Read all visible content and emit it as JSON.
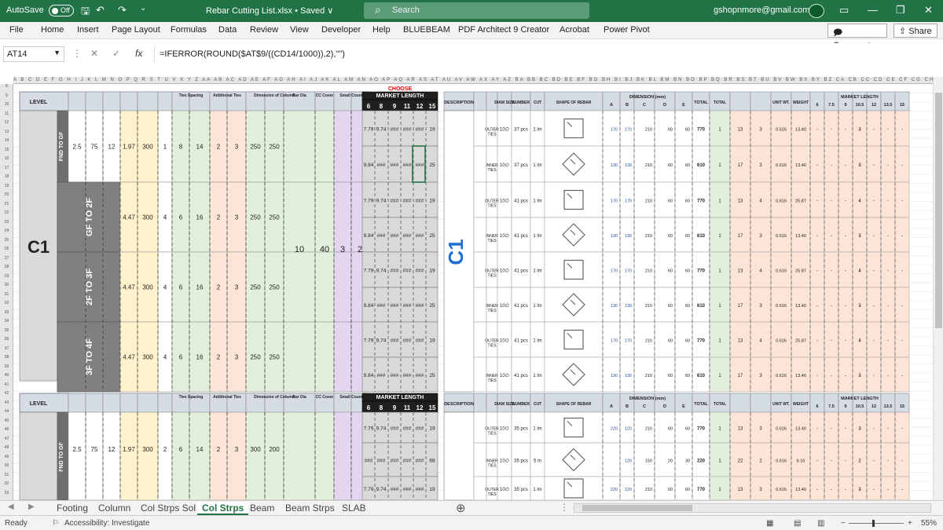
{
  "title_bar": {
    "autosave_label": "AutoSave",
    "autosave_state": "Off",
    "file_title": "Rebar Cutting List.xlsx • Saved ∨",
    "search_placeholder": "Search",
    "user_email": "gshopnmore@gmail.com",
    "window_buttons": [
      "▭",
      "—",
      "❐",
      "✕"
    ]
  },
  "menu": {
    "tabs": [
      "File",
      "Home",
      "Insert",
      "Page Layout",
      "Formulas",
      "Data",
      "Review",
      "View",
      "Developer",
      "Help",
      "BLUEBEAM",
      "PDF Architect 9 Creator",
      "Acrobat",
      "Power Pivot"
    ],
    "comments_label": "Comments",
    "share_label": "Share"
  },
  "formula_bar": {
    "name_box": "AT14",
    "formula": "=IFERROR(ROUND($AT$9/((CD14/1000)),2),\"\")"
  },
  "sheet": {
    "choose_label": "CHOOSE",
    "column_letters": "A B C D E F G H I J K L M N O P Q R S T U V X Y Z AA AB AC AD AE AF AG AH AI AJ AK AL AM AN AO AP AQ AR AS AT AU AV AW AX AY AZ BA BB BC BD BE BF BG BH BI BJ BK BL BM BN BO BP BQ BR BS BT BU BV BW BX BY BZ CA CB CC CD CE CF CG CH CI CJ CK CL CM CN CO CP CQ CR CS CT CU CV CW CX CY CZ DA DB DC DD DE DF DG DH DI DJ DK DL DM DN",
    "row_numbers": [
      "8",
      "9",
      "10",
      "11",
      "12",
      "13",
      "14",
      "15",
      "16",
      "17",
      "18",
      "19",
      "20",
      "21",
      "22",
      "23",
      "24",
      "25",
      "26",
      "27",
      "28",
      "29",
      "30",
      "31",
      "32",
      "33",
      "34",
      "35",
      "36",
      "37",
      "38",
      "39",
      "40",
      "41",
      "42",
      "43",
      "44",
      "45",
      "46",
      "47",
      "48",
      "49",
      "50",
      "51",
      "52",
      "53"
    ],
    "header_block": {
      "level": "LEVEL",
      "market_length": "MARKET LENGTH",
      "description": "DESCRIPTION",
      "dia_size": "DIAM SIZE",
      "number_pcs": "NUMBER OF PCS AT EACH",
      "length_cut": "LENGTH TO CUT",
      "shape": "SHAPE OF REBAR",
      "dimension": "DIMENSION (mm)",
      "dim_cols": [
        "A",
        "B",
        "C",
        "D",
        "E"
      ],
      "total": "TOTAL",
      "total_sets": "TOTAL NUMBER OF SETS",
      "produce": "PCS PRODUCE D FOR EACH BAR",
      "number_market": "NUMBER MARKET SAW LENGTH",
      "unit_wt": "UNIT WT.",
      "weight": "WEIGHT",
      "market_length_right": "MARKET LENGTH",
      "mlr_cols": [
        "6",
        "7.5",
        "9",
        "10.5",
        "12",
        "13.5",
        "15"
      ],
      "ml_cols": [
        "6",
        "8",
        "9",
        "11",
        "12",
        "15"
      ],
      "group_tiles": "Ties Spacing",
      "group_add": "Additional Ties",
      "group_dim": "Dimension of Column",
      "group_cc": "CC Cover",
      "group_bar": "Bar Dia",
      "group_small": "Small Count"
    },
    "column_name": "C1",
    "levels": [
      "FND TO GF",
      "GF TO 2F",
      "2F TO 3F",
      "3F TO 4F"
    ],
    "level_values": [
      {
        "d": "2.5",
        "e": "75",
        "f": "12",
        "g": "1.97",
        "h": "300",
        "i": "1",
        "j": "8",
        "k": "14",
        "l": "2",
        "m": "3",
        "n": "250",
        "o": "250"
      },
      {
        "d": "",
        "e": "",
        "f": "",
        "g": "4.47",
        "h": "300",
        "i": "4",
        "j": "6",
        "k": "16",
        "l": "2",
        "m": "3",
        "n": "250",
        "o": "250"
      },
      {
        "d": "",
        "e": "",
        "f": "",
        "g": "4.47",
        "h": "300",
        "i": "4",
        "j": "6",
        "k": "16",
        "l": "2",
        "m": "3",
        "n": "250",
        "o": "250"
      },
      {
        "d": "",
        "e": "",
        "f": "",
        "g": "4.47",
        "h": "300",
        "i": "4",
        "j": "6",
        "k": "16",
        "l": "2",
        "m": "3",
        "n": "250",
        "o": "250"
      }
    ],
    "shared_vals": [
      "10",
      "40",
      "3",
      "2"
    ],
    "ml_rows": [
      [
        "7.79",
        "9.74",
        "###",
        "###",
        "###",
        "19"
      ],
      [
        "9.84",
        "###",
        "###",
        "###",
        "###",
        "25"
      ]
    ],
    "tie_rows": [
      {
        "desc": "OUTER TIES",
        "dia": "10∅",
        "pcs": "37 pcs",
        "cut": "1 lm",
        "dims": [
          "170",
          "170",
          "210",
          "60",
          "60"
        ],
        "total": "770",
        "sets": "1",
        "prod": "13",
        "num": "3",
        "wt": "0.616",
        "weight": "13.40",
        "mlr": "3"
      },
      {
        "desc": "INNER TIES",
        "dia": "10∅",
        "pcs": "37 pcs",
        "cut": "1 lm",
        "dims": [
          "130",
          "130",
          "210",
          "60",
          "60"
        ],
        "total": "610",
        "sets": "1",
        "prod": "17",
        "num": "3",
        "wt": "0.616",
        "weight": "13.40",
        "mlr": "3"
      },
      {
        "desc": "OUTER TIES",
        "dia": "10∅",
        "pcs": "41 pcs",
        "cut": "1 lm",
        "dims": [
          "170",
          "170",
          "210",
          "60",
          "60"
        ],
        "total": "770",
        "sets": "1",
        "prod": "13",
        "num": "4",
        "wt": "0.616",
        "weight": "25.87",
        "mlr": "4"
      },
      {
        "desc": "INNER TIES",
        "dia": "10∅",
        "pcs": "41 pcs",
        "cut": "1 lm",
        "dims": [
          "130",
          "130",
          "210",
          "60",
          "60"
        ],
        "total": "610",
        "sets": "1",
        "prod": "17",
        "num": "3",
        "wt": "0.616",
        "weight": "13.40",
        "mlr": "3"
      },
      {
        "desc": "OUTER TIES",
        "dia": "10∅",
        "pcs": "41 pcs",
        "cut": "1 lm",
        "dims": [
          "170",
          "170",
          "210",
          "60",
          "60"
        ],
        "total": "770",
        "sets": "1",
        "prod": "13",
        "num": "4",
        "wt": "0.616",
        "weight": "25.87",
        "mlr": "4"
      },
      {
        "desc": "INNER TIES",
        "dia": "10∅",
        "pcs": "41 pcs",
        "cut": "1 lm",
        "dims": [
          "130",
          "130",
          "210",
          "60",
          "60"
        ],
        "total": "610",
        "sets": "1",
        "prod": "17",
        "num": "3",
        "wt": "0.616",
        "weight": "13.40",
        "mlr": "3"
      },
      {
        "desc": "OUTER TIES",
        "dia": "10∅",
        "pcs": "41 pcs",
        "cut": "1 lm",
        "dims": [
          "170",
          "170",
          "210",
          "60",
          "60"
        ],
        "total": "770",
        "sets": "1",
        "prod": "13",
        "num": "4",
        "wt": "0.616",
        "weight": "25.87",
        "mlr": "4"
      },
      {
        "desc": "INNER TIES",
        "dia": "10∅",
        "pcs": "41 pcs",
        "cut": "1 lm",
        "dims": [
          "130",
          "130",
          "210",
          "60",
          "60"
        ],
        "total": "610",
        "sets": "1",
        "prod": "17",
        "num": "3",
        "wt": "0.616",
        "weight": "13.40",
        "mlr": "3"
      }
    ],
    "bottom_block": {
      "level": "FND TO GF",
      "values": {
        "d": "2.5",
        "e": "75",
        "f": "12",
        "g": "1.97",
        "h": "300",
        "i": "2",
        "j": "6",
        "k": "14",
        "l": "2",
        "m": "3",
        "n": "300",
        "o": "200"
      },
      "ml_rows": [
        [
          "7.79",
          "9.74",
          "###",
          "###",
          "###",
          "19"
        ],
        [
          "###",
          "###",
          "###",
          "###",
          "###",
          "68"
        ],
        [
          "7.79",
          "9.74",
          "###",
          "###",
          "###",
          "19"
        ]
      ],
      "tie_rows": [
        {
          "desc": "OUTER TIES",
          "dia": "10∅",
          "pcs": "35 pcs",
          "cut": "1 lm",
          "dims": [
            "220",
            "120",
            "210",
            "60",
            "60"
          ],
          "total": "770",
          "sets": "1",
          "prod": "13",
          "num": "3",
          "wt": "0.616",
          "weight": "13.40",
          "mlr": "3"
        },
        {
          "desc": "INNER TIES",
          "dia": "10∅",
          "pcs": "35 pcs",
          "cut": "5 m",
          "dims": [
            "",
            "120",
            "150",
            "20",
            "30"
          ],
          "total": "220",
          "sets": "1",
          "prod": "22",
          "num": "2",
          "wt": "0.616",
          "weight": "6.16",
          "mlr": "2"
        },
        {
          "desc": "OUTER TIES",
          "dia": "10∅",
          "pcs": "35 pcs",
          "cut": "1 lm",
          "dims": [
            "220",
            "120",
            "210",
            "60",
            "60"
          ],
          "total": "770",
          "sets": "1",
          "prod": "13",
          "num": "3",
          "wt": "0.616",
          "weight": "13.40",
          "mlr": "3"
        }
      ]
    }
  },
  "sheet_tabs": [
    "Footing",
    "Column",
    "Col Strps Sol",
    "Col Strps",
    "Beam",
    "Beam Strps",
    "SLAB"
  ],
  "active_sheet": "Col Strps",
  "status": {
    "ready": "Ready",
    "accessibility": "Accessibility: Investigate",
    "zoom": "55%"
  },
  "colors": {
    "excel_green": "#217346",
    "header_fill": "#d6dce4",
    "col_green": "#e2efda",
    "col_yellow": "#fff2cc",
    "col_orange": "#fce4d6",
    "col_purple": "#e4d5f0",
    "level_dark": "#808080",
    "market_dark": "#1f1f1f",
    "c1_blue": "#1f6fd4"
  }
}
